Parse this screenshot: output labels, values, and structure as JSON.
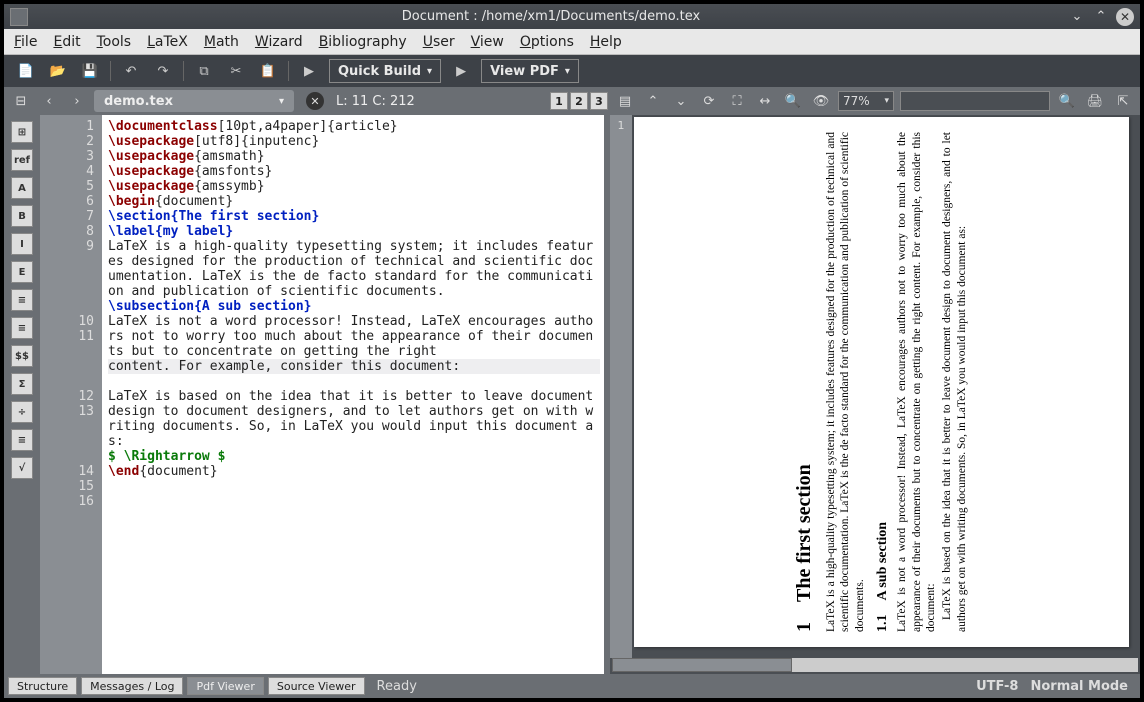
{
  "title": "Document : /home/xm1/Documents/demo.tex",
  "menu": {
    "file": "File",
    "edit": "Edit",
    "tools": "Tools",
    "latex": "LaTeX",
    "math": "Math",
    "wizard": "Wizard",
    "bibliography": "Bibliography",
    "user": "User",
    "view": "View",
    "options": "Options",
    "help": "Help"
  },
  "toolbar": {
    "quick_build": "Quick Build",
    "view_pdf": "View PDF"
  },
  "secondbar": {
    "tab_name": "demo.tex",
    "cursor_info": "L: 11 C: 212",
    "pages": [
      "1",
      "2",
      "3"
    ],
    "zoom": "77%"
  },
  "left_tools": [
    "⊞",
    "ref",
    "A",
    "B",
    "I",
    "E",
    "≡",
    "≡",
    "$$",
    "Σ",
    "÷",
    "≡",
    "√"
  ],
  "code_lines": [
    {
      "n": "1",
      "html": "<span class='cmd'>\\documentclass</span>[10pt,a4paper]{article}"
    },
    {
      "n": "2",
      "html": "<span class='cmd'>\\usepackage</span>[utf8]{inputenc}"
    },
    {
      "n": "3",
      "html": "<span class='cmd'>\\usepackage</span>{amsmath}"
    },
    {
      "n": "4",
      "html": "<span class='cmd'>\\usepackage</span>{amsfonts}"
    },
    {
      "n": "5",
      "html": "<span class='cmd'>\\usepackage</span>{amssymb}"
    },
    {
      "n": "6",
      "html": "<span class='cmd'>\\begin</span>{document}"
    },
    {
      "n": "7",
      "html": "<span class='sec'>\\section{The first section}</span>"
    },
    {
      "n": "8",
      "html": "<span class='sec'>\\label{my label}</span>"
    },
    {
      "n": "9",
      "html": "LaTeX is a high-quality typesetting system; it includes features designed for the production of technical and scientific documentation. LaTeX is the de facto standard for the communication and publication of scientific documents."
    },
    {
      "n": "10",
      "html": "<span class='sec'>\\subsection{A sub section}</span>"
    },
    {
      "n": "11",
      "html": "LaTeX is not a word processor! Instead, LaTeX encourages authors not to worry too much about the appearance of their documents but to concentrate on getting the right <span class='hl'>content. For example, consider this document:</span>"
    },
    {
      "n": "12",
      "html": ""
    },
    {
      "n": "13",
      "html": "LaTeX is based on the idea that it is better to leave document design to document designers, and to let authors get on with writing documents. So, in LaTeX you would input this document as:"
    },
    {
      "n": "14",
      "html": "<span class='math'>$ \\Rightarrow $</span>"
    },
    {
      "n": "15",
      "html": "<span class='cmd'>\\end</span>{document}"
    },
    {
      "n": "16",
      "html": ""
    }
  ],
  "gutter_physical": [
    "1",
    "2",
    "3",
    "4",
    "5",
    "6",
    "7",
    "8",
    "9",
    "",
    "",
    "",
    "",
    "10",
    "11",
    "",
    "",
    "",
    "12",
    "13",
    "",
    "",
    "",
    "14",
    "15",
    "16"
  ],
  "pdf": {
    "page_label": "1",
    "h1": "1 The first section",
    "p1": "LaTeX is a high-quality typesetting system; it includes features designed for the production of technical and scientific documentation. LaTeX is the de facto standard for the communication and publication of scientific documents.",
    "h2": "1.1 A sub section",
    "p2": "LaTeX is not a word processor! Instead, LaTeX encourages authors not to worry too much about the appearance of their documents but to concentrate on getting the right content. For example, consider this document:",
    "p3": "LaTeX is based on the idea that it is better to leave document design to document designers, and to let authors get on with writing documents. So, in LaTeX you would input this document as:"
  },
  "bottom": {
    "structure": "Structure",
    "messages": "Messages / Log",
    "pdf_viewer": "Pdf Viewer",
    "source_viewer": "Source Viewer",
    "status": "Ready",
    "encoding": "UTF-8",
    "mode": "Normal Mode"
  }
}
